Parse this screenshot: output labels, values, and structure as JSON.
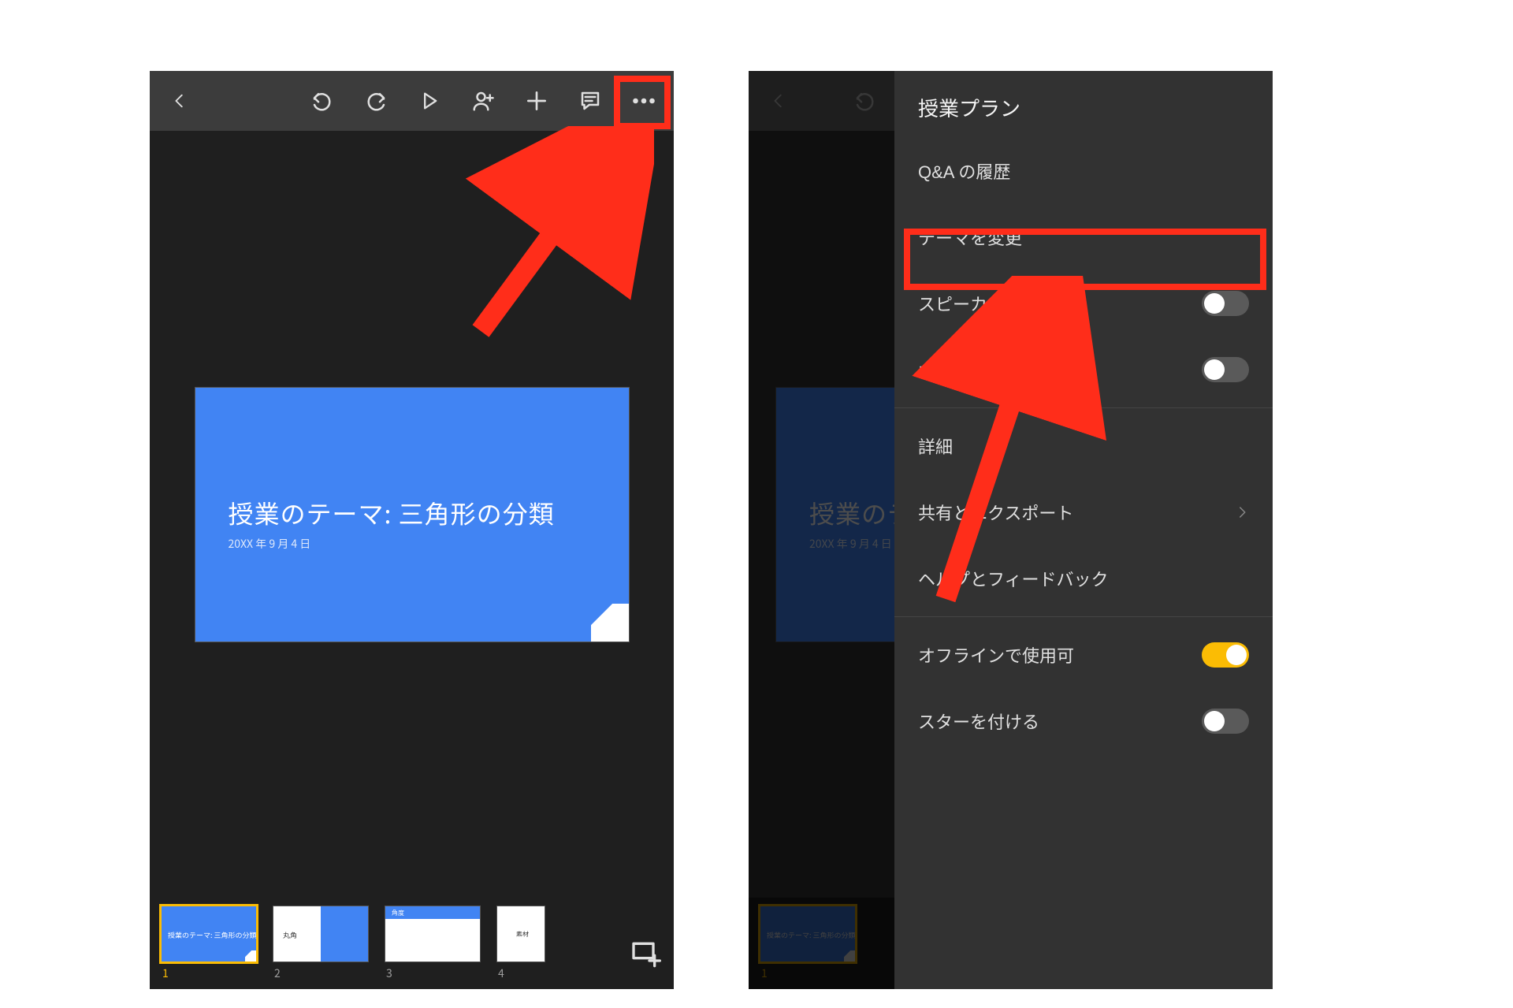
{
  "colors": {
    "accent": "#4184f3",
    "highlight": "#ff2d1a",
    "selection": "#fbbc04",
    "toggle_on": "#fbbc04",
    "toolbar_bg": "#3c3c3c",
    "editor_bg": "#1f1f1f",
    "panel_bg": "#323232"
  },
  "slide": {
    "title": "授業のテーマ: 三角形の分類",
    "date": "20XX 年 9 月 4 日"
  },
  "toolbar": {
    "icons": {
      "back": "back-arrow-icon",
      "undo": "undo-icon",
      "redo": "redo-icon",
      "play": "play-icon",
      "share_person": "person-add-icon",
      "add": "plus-icon",
      "comment": "comment-icon",
      "more": "more-horizontal-icon"
    }
  },
  "thumbnails": {
    "items": [
      {
        "num": "1",
        "mini_title": "授業のテーマ: 三角形の分類",
        "selected": true
      },
      {
        "num": "2",
        "mini_title": "丸角",
        "selected": false
      },
      {
        "num": "3",
        "mini_title": "角度",
        "selected": false
      },
      {
        "num": "4",
        "mini_title": "素材",
        "selected": false
      }
    ],
    "add_icon": "new-slide-icon"
  },
  "menu": {
    "title": "授業プラン",
    "items": [
      {
        "label": "Q&A の履歴",
        "type": "link"
      },
      {
        "label": "テーマを変更",
        "type": "link",
        "highlighted": true
      },
      {
        "label": "スピーカー ノート",
        "type": "toggle",
        "on": false
      },
      {
        "label": "ガイドを表示",
        "type": "toggle",
        "on": false
      },
      {
        "label": "詳細",
        "type": "link"
      },
      {
        "label": "共有とエクスポート",
        "type": "link",
        "disclosure": true
      },
      {
        "label": "ヘルプとフィードバック",
        "type": "link"
      },
      {
        "label": "オフラインで使用可",
        "type": "toggle",
        "on": true
      },
      {
        "label": "スターを付ける",
        "type": "toggle",
        "on": false
      }
    ]
  }
}
